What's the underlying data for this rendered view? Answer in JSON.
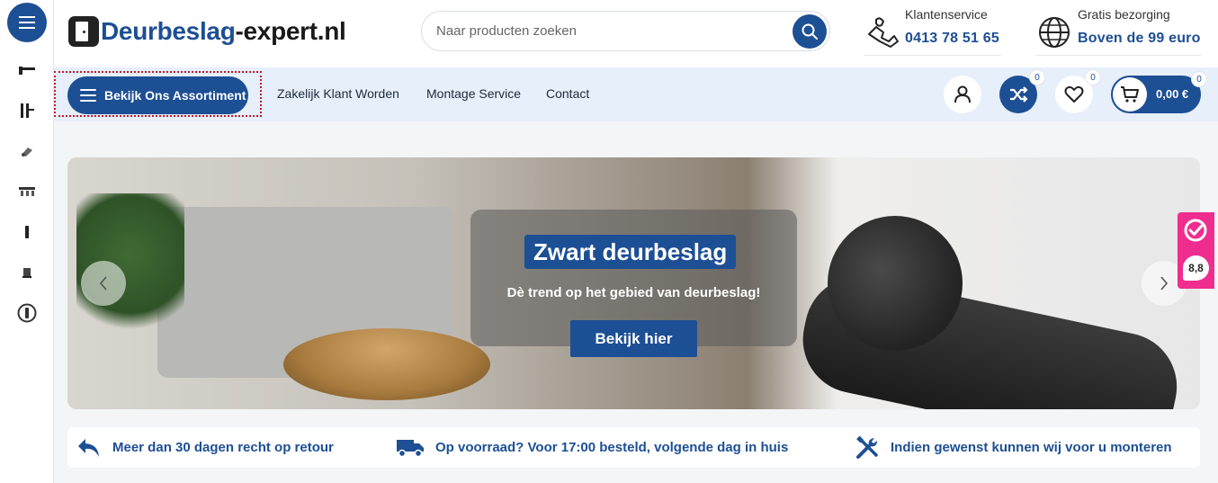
{
  "rail": {
    "items": [
      "lever-handle-icon",
      "door-hinge-icon",
      "door-closer-icon",
      "lock-set-icon",
      "door-pull-icon",
      "door-stop-icon",
      "round-knob-icon"
    ]
  },
  "header": {
    "logo_part1": "Deurbeslag",
    "logo_part2": "-expert.nl",
    "search_placeholder": "Naar producten zoeken",
    "service_label": "Klantenservice",
    "service_phone": "0413 78 51 65",
    "delivery_label": "Gratis bezorging",
    "delivery_value": "Boven de 99 euro"
  },
  "nav": {
    "assortment_label": "Bekijk Ons Assortiment",
    "links": [
      "Zakelijk Klant Worden",
      "Montage Service",
      "Contact"
    ],
    "compare_count": "0",
    "wishlist_count": "0",
    "cart_count": "0",
    "cart_total": "0,00 €"
  },
  "hero": {
    "title": "Zwart deurbeslag",
    "subtitle": "Dè trend op het gebied van deurbeslag!",
    "cta": "Bekijk hier"
  },
  "rating": {
    "score": "8,8"
  },
  "usps": [
    "Meer dan 30 dagen recht op retour",
    "Op voorraad? Voor 17:00 besteld, volgende dag in huis",
    "Indien gewenst kunnen wij voor u monteren"
  ],
  "colors": {
    "brand": "#1d4f94",
    "navbar_bg": "#e6effa",
    "rating_pink": "#ef2d8f"
  }
}
